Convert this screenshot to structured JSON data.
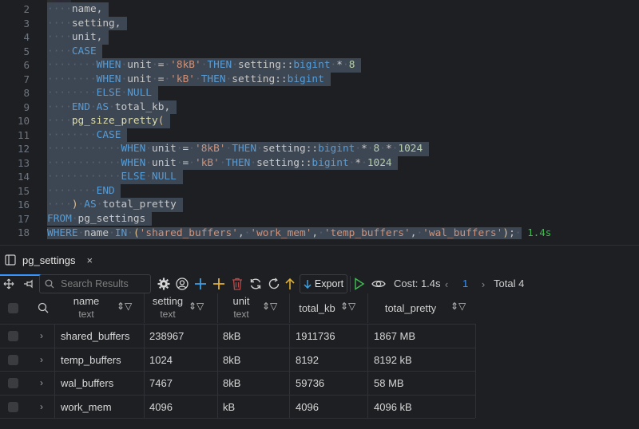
{
  "editor": {
    "lines": [
      {
        "num": "2"
      },
      {
        "num": "3"
      },
      {
        "num": "4"
      },
      {
        "num": "5"
      },
      {
        "num": "6"
      },
      {
        "num": "7"
      },
      {
        "num": "8"
      },
      {
        "num": "9"
      },
      {
        "num": "10"
      },
      {
        "num": "11"
      },
      {
        "num": "12"
      },
      {
        "num": "13"
      },
      {
        "num": "14"
      },
      {
        "num": "15"
      },
      {
        "num": "16"
      },
      {
        "num": "17"
      },
      {
        "num": "18"
      }
    ],
    "timing": "1.4s"
  },
  "panel": {
    "tab_label": "pg_settings",
    "tab_close": "×"
  },
  "toolbar": {
    "search_placeholder": "Search Results",
    "export_label": "Export",
    "cost_label": "Cost: 1.4s",
    "page_number": "1",
    "total_label": "Total 4"
  },
  "grid": {
    "columns": [
      {
        "name": "name",
        "type": "text"
      },
      {
        "name": "setting",
        "type": "text"
      },
      {
        "name": "unit",
        "type": "text"
      },
      {
        "name": "total_kb",
        "type": ""
      },
      {
        "name": "total_pretty",
        "type": ""
      }
    ],
    "rows": [
      [
        "shared_buffers",
        "238967",
        "8kB",
        "1911736",
        "1867 MB"
      ],
      [
        "temp_buffers",
        "1024",
        "8kB",
        "8192",
        "8192 kB"
      ],
      [
        "wal_buffers",
        "7467",
        "8kB",
        "59736",
        "58 MB"
      ],
      [
        "work_mem",
        "4096",
        "kB",
        "4096",
        "4096 kB"
      ]
    ]
  },
  "colors": {
    "accent": "#3794ff",
    "keyword": "#569cd6",
    "string": "#ce9178",
    "number": "#b5cea8",
    "success": "#3fb950"
  }
}
